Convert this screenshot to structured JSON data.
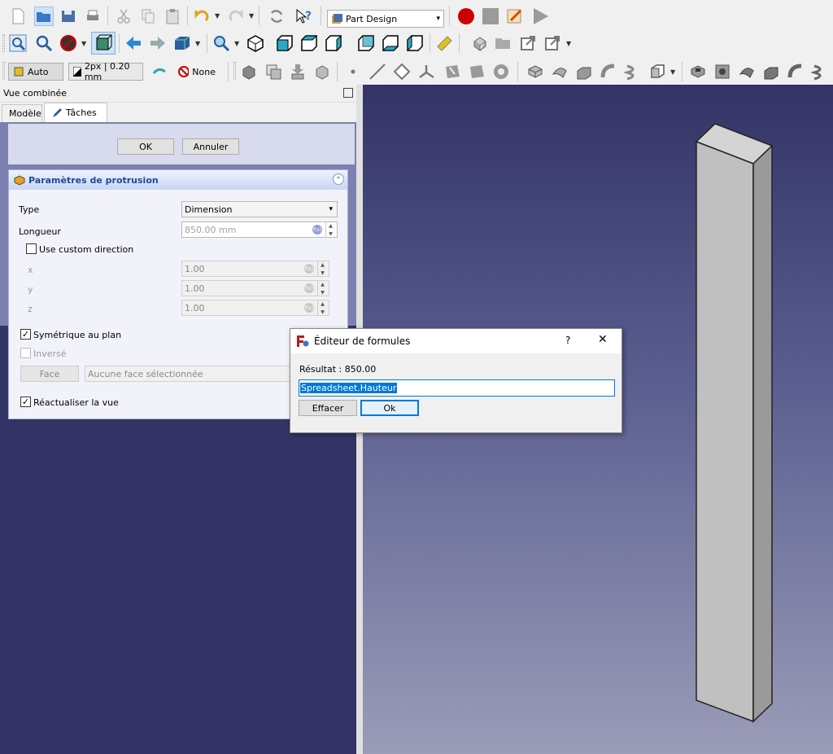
{
  "toolbar": {
    "workbench": "Part Design",
    "draw_style": "Auto",
    "line_width": "2px | 0.20 mm",
    "selection_filter": "None"
  },
  "combo_view": {
    "title": "Vue combinée",
    "tabs": [
      {
        "label": "Modèle"
      },
      {
        "label": "Tâches"
      }
    ]
  },
  "task": {
    "ok": "OK",
    "cancel": "Annuler"
  },
  "params": {
    "title": "Paramètres de protrusion",
    "type_label": "Type",
    "type_value": "Dimension",
    "length_label": "Longueur",
    "length_value": "850.00 mm",
    "custom_direction": "Use custom direction",
    "x_label": "x",
    "x_value": "1.00",
    "y_label": "y",
    "y_value": "1.00",
    "z_label": "z",
    "z_value": "1.00",
    "symmetric": "Symétrique au plan",
    "reversed": "Inversé",
    "face_button": "Face",
    "face_value": "Aucune face sélectionnée",
    "refresh": "Réactualiser la vue"
  },
  "formula_dialog": {
    "title": "Éditeur de formules",
    "help": "?",
    "result": "Résultat : 850.00",
    "expression": "Spreadsheet.Hauteur",
    "clear": "Effacer",
    "ok": "Ok"
  },
  "colors": {
    "record": "#cc0000",
    "accent": "#0078d7",
    "viewport_top": "#333366",
    "viewport_bottom": "#9a9cb8",
    "model_face": "#b8b8b8"
  }
}
